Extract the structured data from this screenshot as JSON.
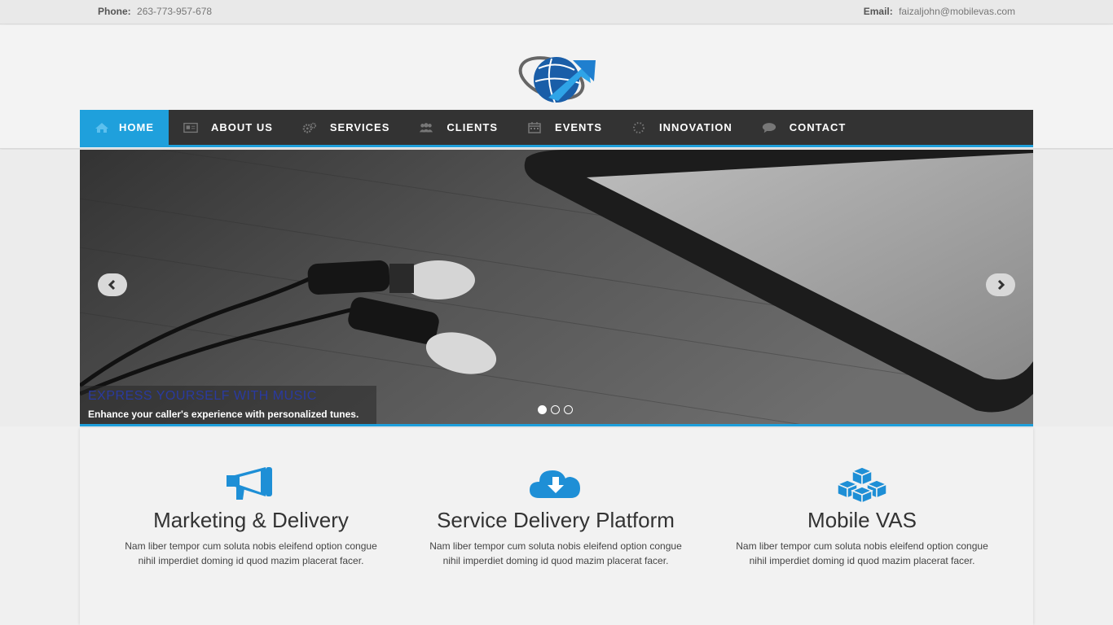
{
  "topbar": {
    "phone_label": "Phone:",
    "phone": "263-773-957-678",
    "email_label": "Email:",
    "email": "faizaljohn@mobilevas.com"
  },
  "nav": {
    "items": [
      {
        "label": "HOME",
        "icon": "home-icon",
        "active": true
      },
      {
        "label": "ABOUT US",
        "icon": "newspaper-icon"
      },
      {
        "label": "SERVICES",
        "icon": "gears-icon"
      },
      {
        "label": "CLIENTS",
        "icon": "users-icon"
      },
      {
        "label": "EVENTS",
        "icon": "calendar-icon"
      },
      {
        "label": "INNOVATION",
        "icon": "spinner-icon"
      },
      {
        "label": "CONTACT",
        "icon": "chat-bubble-icon"
      }
    ]
  },
  "slider": {
    "caption_title": "Express Yourself With Music",
    "caption_text": "Enhance your caller's experience with personalized tunes.",
    "slide_count": 3,
    "active_slide": 1
  },
  "features": [
    {
      "icon": "megaphone-icon",
      "title": "Marketing & Delivery",
      "text": "Nam liber tempor cum soluta nobis eleifend option congue nihil imperdiet doming id quod mazim placerat facer."
    },
    {
      "icon": "cloud-download-icon",
      "title": "Service Delivery Platform",
      "text": "Nam liber tempor cum soluta nobis eleifend option congue nihil imperdiet doming id quod mazim placerat facer."
    },
    {
      "icon": "cubes-icon",
      "title": "Mobile VAS",
      "text": "Nam liber tempor cum soluta nobis eleifend option congue nihil imperdiet doming id quod mazim placerat facer."
    }
  ],
  "colors": {
    "accent": "#1fa0dc",
    "nav_bg": "#333333",
    "icon_blue": "#1e8fd6"
  }
}
